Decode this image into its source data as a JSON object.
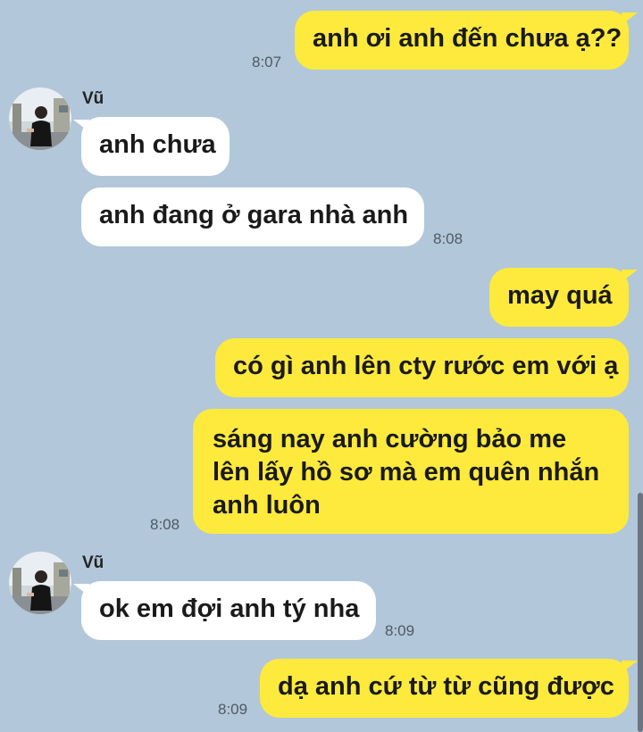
{
  "contact": {
    "name": "Vũ",
    "avatar_icon": "person-photo-avatar"
  },
  "colors": {
    "background": "#b2c7d9",
    "outgoing_bubble": "#fdea3c",
    "incoming_bubble": "#ffffff",
    "time_text": "#4e5a66"
  },
  "messages": [
    {
      "direction": "out",
      "text": "anh ơi anh đến chưa ạ??",
      "time": "8:07"
    },
    {
      "direction": "in",
      "sender": "Vũ",
      "text": "anh chưa"
    },
    {
      "direction": "in",
      "text": "anh đang ở gara nhà anh",
      "time": "8:08"
    },
    {
      "direction": "out",
      "text": "may quá"
    },
    {
      "direction": "out",
      "text": "có gì anh lên cty rước em với ạ"
    },
    {
      "direction": "out",
      "text": "sáng nay anh cường bảo me lên lấy hồ sơ mà em quên nhắn anh luôn",
      "time": "8:08"
    },
    {
      "direction": "in",
      "sender": "Vũ",
      "text": "ok em đợi anh tý nha",
      "time": "8:09"
    },
    {
      "direction": "out",
      "text": "dạ anh cứ từ từ cũng được",
      "time": "8:09"
    }
  ]
}
